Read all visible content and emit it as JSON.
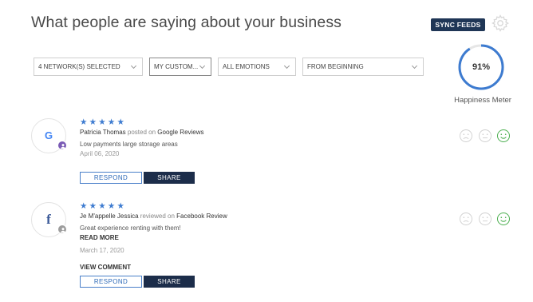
{
  "header": {
    "title": "What people are saying about your business",
    "sync_label": "SYNC FEEDS",
    "settings_icon": "gear-icon"
  },
  "filters": [
    {
      "label": "4 NETWORK(S) SELECTED"
    },
    {
      "label": "MY CUSTOM..."
    },
    {
      "label": "ALL EMOTIONS"
    },
    {
      "label": "FROM BEGINNING"
    }
  ],
  "happiness": {
    "value": "91%",
    "fraction": 0.91,
    "label": "Happiness Meter",
    "color": "#3d7bd0"
  },
  "reviews": [
    {
      "network_icon": "google-icon",
      "network_glyph": "G",
      "stars": "★★★★★",
      "rating": 5,
      "author": "Patricia Thomas",
      "verb": "posted on",
      "network": "Google Reviews",
      "text": "Low payments large storage areas",
      "date": "April 06, 2020",
      "respond_label": "RESPOND",
      "share_label": "SHARE",
      "selected_emotion": "happy"
    },
    {
      "network_icon": "facebook-icon",
      "network_glyph": "f",
      "stars": "★★★★★",
      "rating": 5,
      "author": "Je M'appelle Jessica",
      "verb": "reviewed on",
      "network": "Facebook Review",
      "text": "Great experience renting with them!",
      "read_more": "READ MORE",
      "date": "March 17, 2020",
      "view_comment": "VIEW COMMENT",
      "respond_label": "RESPOND",
      "share_label": "SHARE",
      "selected_emotion": "happy"
    }
  ],
  "colors": {
    "accent": "#3d7bd0",
    "dark": "#1c2d4a",
    "happy": "#4caf50",
    "neutral_face": "#cccccc"
  }
}
